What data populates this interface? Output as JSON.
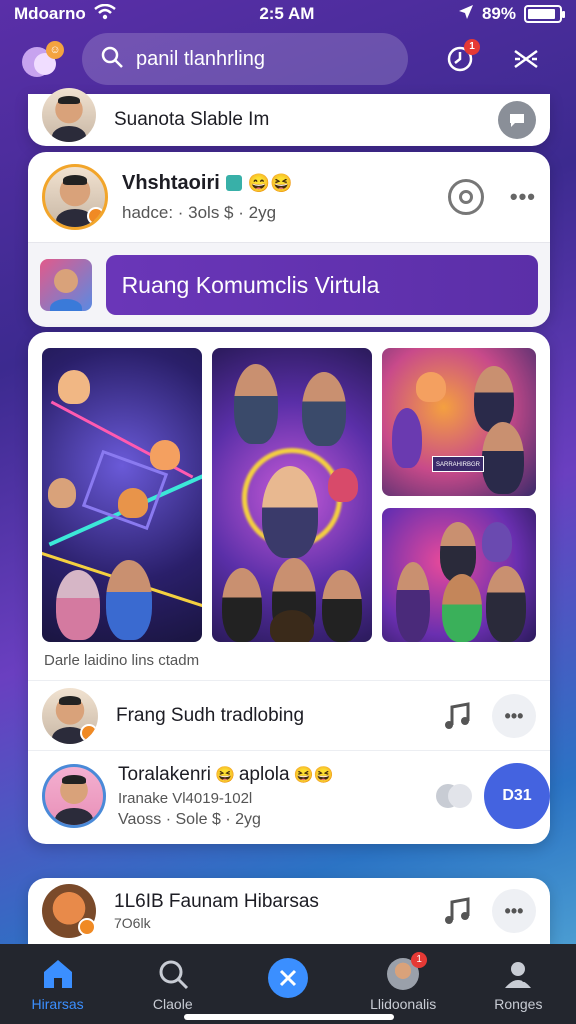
{
  "status_bar": {
    "carrier": "Mdoarno",
    "time": "2:5 AM",
    "battery": "89%",
    "battery_level": 0.89
  },
  "search": {
    "placeholder": "panil tlanhrling"
  },
  "top_bar": {
    "notification_count": "1"
  },
  "card_top": {
    "title": "Suanota Slable Im"
  },
  "profile_card": {
    "name": "Vhshtaoiri",
    "emojis": "😄😆",
    "meta": "hadce: · 3ols  $ · 2yg",
    "banner": "Ruang Komumclis Virtula"
  },
  "gallery": {
    "caption": "Darle laidino lins ctadm",
    "sign_text": "SARRAHIRBGR"
  },
  "list_items": [
    {
      "title": "Frang Sudh tradlobing"
    },
    {
      "title": "Toralakenri",
      "title_emoji": "😆",
      "title_rest": "aplola",
      "title_emojis2": "😆😆",
      "line2": "Iranake Vl4019-102l",
      "line3": "Vaoss · Sole  $ · 2yg",
      "fab": "D31"
    }
  ],
  "card_bottom": {
    "title": "1L6IB Faunam Hibarsas",
    "subtitle": "7O6lk"
  },
  "nav": [
    {
      "label": "Hirarsas",
      "icon": "home-icon"
    },
    {
      "label": "Claole",
      "icon": "search-icon"
    },
    {
      "label": "",
      "icon": "x-logo-icon"
    },
    {
      "label": "Llidoonalis",
      "icon": "avatar-icon",
      "badge": "1"
    },
    {
      "label": "Ronges",
      "icon": "profile-icon"
    }
  ],
  "colors": {
    "accent": "#5b2fb0",
    "nav_active": "#3b8fff",
    "fab": "#4463e0"
  }
}
